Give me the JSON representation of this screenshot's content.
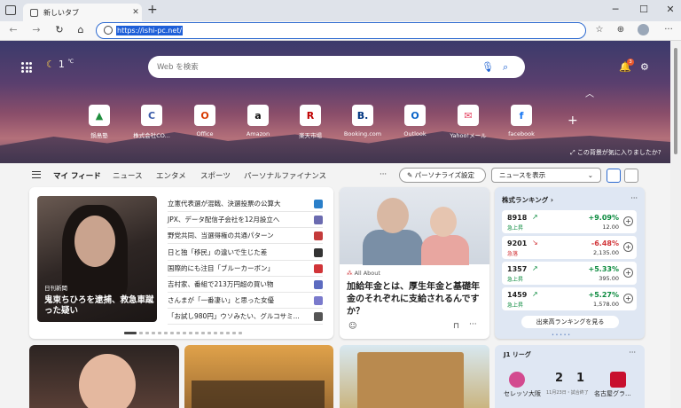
{
  "window": {
    "tab_title": "新しいタブ",
    "url": "https://ishi-pc.net/"
  },
  "header": {
    "temperature": "1",
    "temp_unit": "℃",
    "search_placeholder": "Web を検索",
    "notification_count": "3",
    "bg_question": "この背景が気に入りましたか?"
  },
  "quick_links": [
    {
      "label": "鍋島塾",
      "icon": "drive-icon",
      "glyph": "▲",
      "color": "#1e8e3e"
    },
    {
      "label": "株式会社CO...",
      "icon": "c-icon",
      "glyph": "C",
      "color": "#3a5ba9"
    },
    {
      "label": "Office",
      "icon": "office-icon",
      "glyph": "O",
      "color": "#d83b01"
    },
    {
      "label": "Amazon",
      "icon": "amazon-icon",
      "glyph": "a",
      "color": "#111111"
    },
    {
      "label": "楽天市場",
      "icon": "rakuten-icon",
      "glyph": "R",
      "color": "#bf0000"
    },
    {
      "label": "Booking.com",
      "icon": "booking-icon",
      "glyph": "B.",
      "color": "#003580"
    },
    {
      "label": "Outlook",
      "icon": "outlook-icon",
      "glyph": "O",
      "color": "#0a64c8"
    },
    {
      "label": "Yahoo!メール",
      "icon": "yahoo-mail-icon",
      "glyph": "✉",
      "color": "#e4405f"
    },
    {
      "label": "facebook",
      "icon": "facebook-icon",
      "glyph": "f",
      "color": "#1877f2"
    }
  ],
  "feed_nav": {
    "tabs": [
      "マイ フィード",
      "ニュース",
      "エンタメ",
      "スポーツ",
      "パーソナルファイナンス"
    ],
    "more": "···",
    "personalize": "パーソナライズ設定",
    "show_news": "ニュースを表示"
  },
  "top_story": {
    "source": "日刊新聞",
    "caption": "鬼束ちひろを逮捕、救急車蹴った疑い"
  },
  "headlines": [
    {
      "text": "立憲代表選が混戦、決選投票の公算大",
      "pub": "#2a7fc9"
    },
    {
      "text": "JPX、データ配信子会社を12月設立へ",
      "pub": "#6b6bb0"
    },
    {
      "text": "野党共同、当選得権の共通パターン",
      "pub": "#c43b3b"
    },
    {
      "text": "日と独「移民」の違いで生じた差",
      "pub": "#333333"
    },
    {
      "text": "国際的にも注目「ブルーカーボン」",
      "pub": "#d13438"
    },
    {
      "text": "吉村家、番組で213万円超の買い物",
      "pub": "#5c6bc0"
    },
    {
      "text": "さんまが「一番凄い」と思った女優",
      "pub": "#7a7acc"
    },
    {
      "text": "「お試し980円」ウソみたい、グルコサミ...",
      "pub": "#555555"
    }
  ],
  "pension_article": {
    "source": "All About",
    "title": "加給年金とは、厚生年金と基礎年金のそれぞれに支給されるんですか？"
  },
  "stocks": {
    "title": "株式ランキング",
    "items": [
      {
        "code": "8918",
        "trend": "急上昇",
        "pct": "+9.09%",
        "price": "12.00",
        "dir": "up"
      },
      {
        "code": "9201",
        "trend": "急落",
        "pct": "-6.48%",
        "price": "2,135.00",
        "dir": "down"
      },
      {
        "code": "1357",
        "trend": "急上昇",
        "pct": "+5.33%",
        "price": "395.00",
        "dir": "up"
      },
      {
        "code": "1459",
        "trend": "急上昇",
        "pct": "+5.27%",
        "price": "1,578.00",
        "dir": "up"
      }
    ],
    "more_link": "出来高ランキングを見る"
  },
  "jleague": {
    "title": "J1 リーグ",
    "home": "セレッソ大阪",
    "away": "名古屋グラ...",
    "home_score": "2",
    "away_score": "1",
    "status": "11月23日・試合終了"
  },
  "colors": {
    "accent": "#2d6ad0",
    "up": "#0b8a3e",
    "down": "#d13438"
  }
}
